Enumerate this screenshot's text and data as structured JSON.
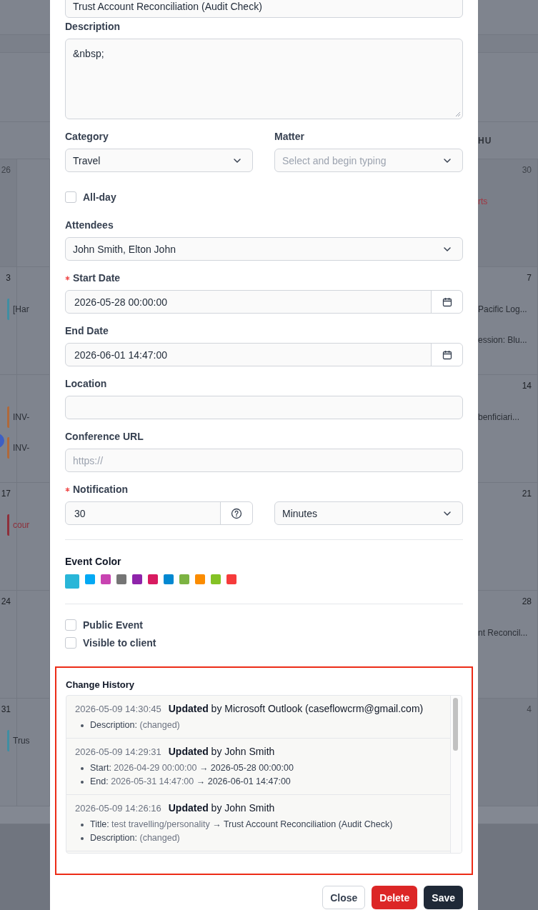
{
  "calendar": {
    "header_right": "HU",
    "weeks": [
      {
        "left": {
          "day": "26",
          "outside": true
        },
        "right": {
          "day": "30",
          "outside": true,
          "events": [
            {
              "text": "rts",
              "kind": "tinted",
              "color": "#a3343f"
            }
          ]
        }
      },
      {
        "left": {
          "day": "3",
          "outside": false,
          "events": [
            {
              "text": "[Har",
              "kind": "plain",
              "color": "#3f8ea3"
            }
          ]
        },
        "right": {
          "day": "7",
          "outside": false,
          "events": [
            {
              "text": "Pacific Log...",
              "kind": "plain"
            },
            {
              "text": "ession: Blu...",
              "kind": "plain"
            }
          ]
        }
      },
      {
        "left": {
          "today": true,
          "events": [
            {
              "text": "INV-",
              "kind": "plain",
              "color": "#b0693a"
            },
            {
              "text": "INV-",
              "kind": "plain",
              "color": "#b0693a"
            }
          ]
        },
        "right": {
          "day": "14",
          "outside": false,
          "events": [
            {
              "text": " benficiari...",
              "kind": "plain"
            }
          ]
        }
      },
      {
        "left": {
          "day": "17",
          "outside": false,
          "events": [
            {
              "text": "cour",
              "kind": "tinted",
              "color": "#8e2f3a"
            }
          ]
        },
        "right": {
          "day": "21",
          "outside": false
        }
      },
      {
        "left": {
          "day": "24",
          "outside": false
        },
        "right": {
          "day": "28",
          "outside": false,
          "events": [
            {
              "text": "nt Reconcil...",
              "kind": "plain"
            }
          ]
        }
      },
      {
        "left": {
          "day": "31",
          "outside": false,
          "events": [
            {
              "text": "Trus",
              "kind": "plain",
              "color": "#3f8ea3"
            }
          ]
        },
        "right": {
          "day": "4",
          "outside": true
        }
      }
    ]
  },
  "modal": {
    "title_field": {
      "value": "Trust Account Reconciliation (Audit Check)"
    },
    "description": {
      "label": "Description",
      "value": "&nbsp;"
    },
    "category": {
      "label": "Category",
      "value": "Travel"
    },
    "matter": {
      "label": "Matter",
      "placeholder": "Select and begin typing"
    },
    "all_day": {
      "label": "All-day",
      "checked": false
    },
    "attendees": {
      "label": "Attendees",
      "value": "John Smith, Elton John"
    },
    "start_date": {
      "label": "Start Date",
      "required": true,
      "value": "2026-05-28 00:00:00"
    },
    "end_date": {
      "label": "End Date",
      "value": "2026-06-01 14:47:00"
    },
    "location": {
      "label": "Location"
    },
    "conference_url": {
      "label": "Conference URL",
      "placeholder": "https://"
    },
    "notification": {
      "label": "Notification",
      "required": true,
      "value": "30",
      "unit": "Minutes"
    },
    "event_color": {
      "label": "Event Color",
      "colors": [
        {
          "color": "#29b6d8",
          "selected": true
        },
        {
          "color": "#03a9f4",
          "selected": false
        },
        {
          "color": "#c843b1",
          "selected": false
        },
        {
          "color": "#757575",
          "selected": false
        },
        {
          "color": "#8e24aa",
          "selected": false
        },
        {
          "color": "#d81b60",
          "selected": false
        },
        {
          "color": "#0288d1",
          "selected": false
        },
        {
          "color": "#7cb342",
          "selected": false
        },
        {
          "color": "#fb8c00",
          "selected": false
        },
        {
          "color": "#84c225",
          "selected": false
        },
        {
          "color": "#f63b3b",
          "selected": false
        }
      ]
    },
    "options": [
      {
        "label": "Public Event",
        "checked": false
      },
      {
        "label": "Visible to client",
        "checked": false
      }
    ],
    "change_history": {
      "title": "Change History",
      "entries": [
        {
          "time": "2026-05-09 14:30:45",
          "summary": "**Updated** by Microsoft Outlook (caseflowcrm@gmail.com)",
          "changes": [
            {
              "kind": "note",
              "field": "Description:",
              "value": "(changed)"
            }
          ]
        },
        {
          "time": "2026-05-09 14:29:31",
          "summary": "**Updated** by John Smith",
          "changes": [
            {
              "kind": "diff",
              "field": "Start:",
              "old": "2026-04-29 00:00:00",
              "arrow": "→",
              "new": "2026-05-28 00:00:00"
            },
            {
              "kind": "diff",
              "field": "End:",
              "old": "2026-05-31 14:47:00",
              "arrow": "→",
              "new": "2026-06-01 14:47:00"
            }
          ]
        },
        {
          "time": "2026-05-09 14:26:16",
          "summary": "**Updated** by John Smith",
          "changes": [
            {
              "kind": "diff",
              "field": "Title:",
              "old": "test travelling/personality",
              "arrow": "→",
              "new": "Trust Account Reconciliation (Audit Check)"
            },
            {
              "kind": "note",
              "field": "Description:",
              "value": "(changed)"
            }
          ]
        }
      ]
    },
    "buttons": [
      {
        "label": "Close",
        "kind": "secondary"
      },
      {
        "label": "Delete",
        "kind": "danger"
      },
      {
        "label": "Save",
        "kind": "primary"
      }
    ]
  }
}
